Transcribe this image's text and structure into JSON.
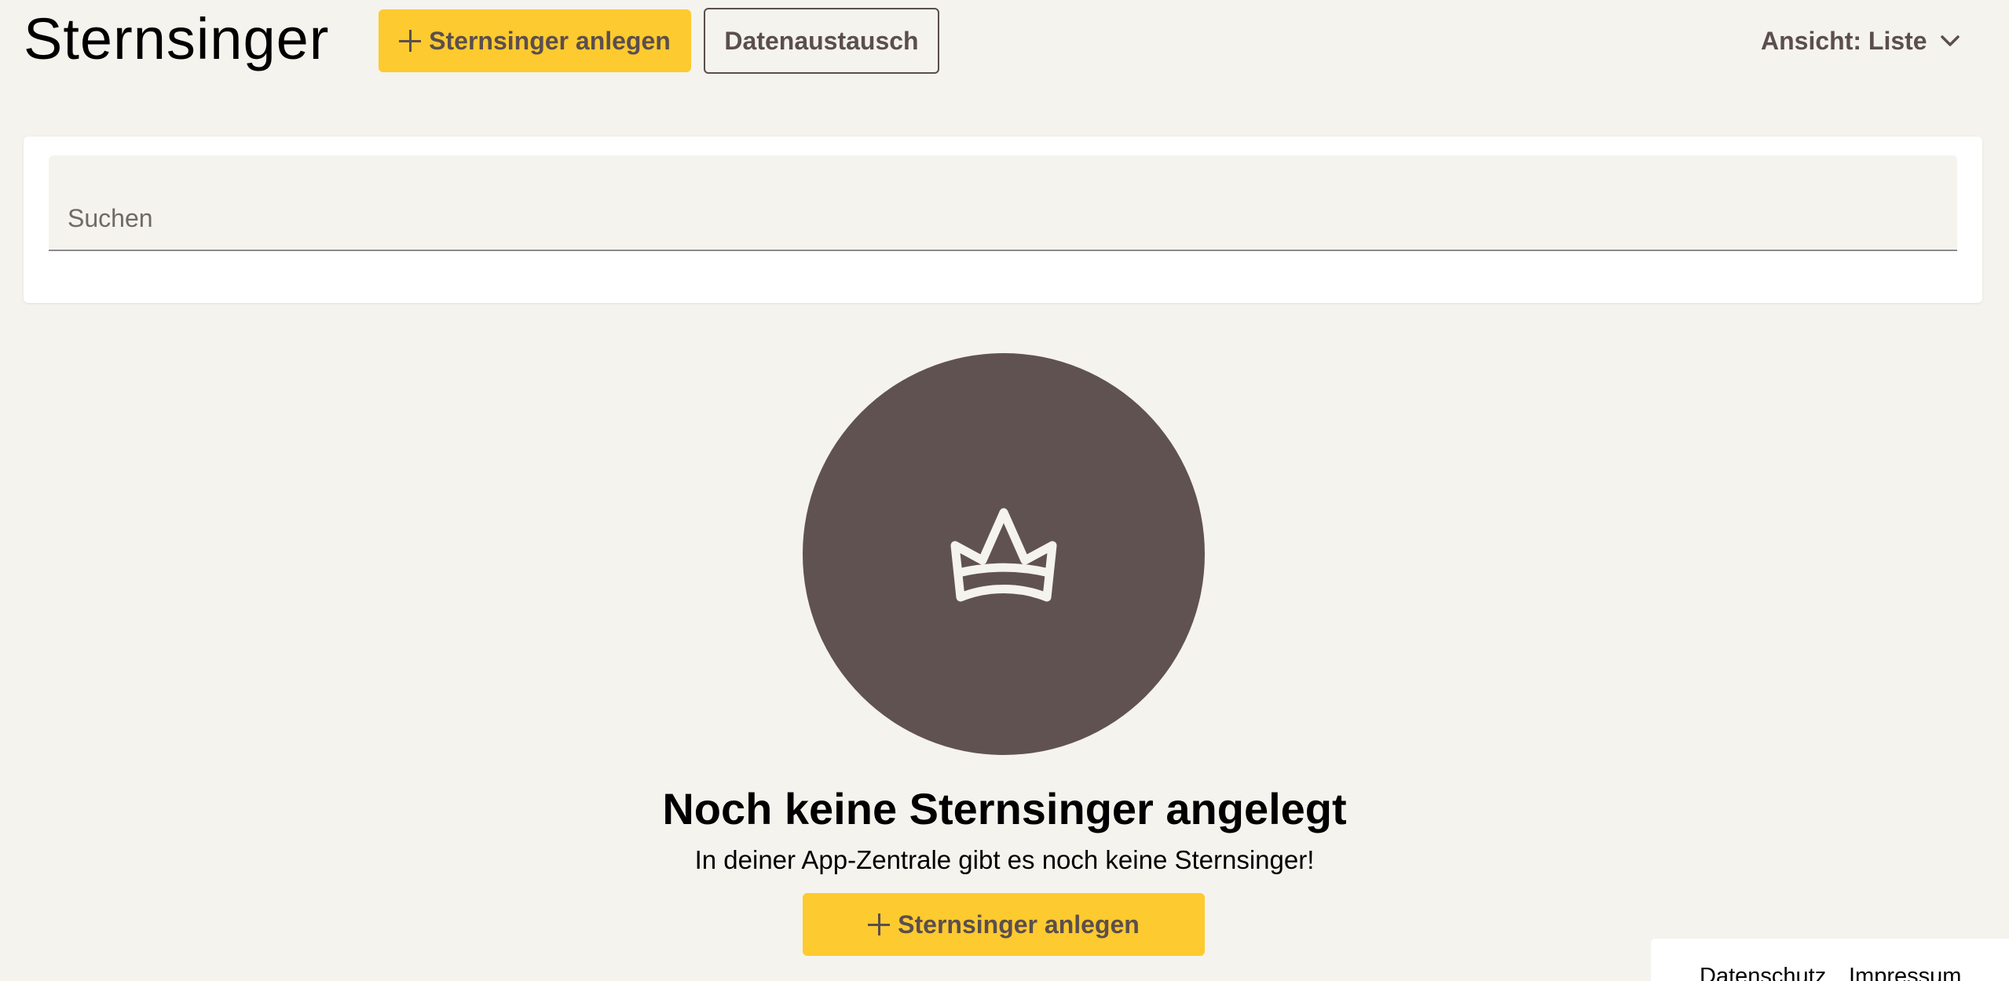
{
  "header": {
    "title": "Sternsinger",
    "create_label": "Sternsinger anlegen",
    "exchange_label": "Datenaustausch",
    "view_label": "Ansicht: Liste"
  },
  "search": {
    "placeholder": "Suchen"
  },
  "empty_state": {
    "title": "Noch keine Sternsinger angelegt",
    "text": "In deiner App-Zentrale gibt es noch keine Sternsinger!",
    "create_label": "Sternsinger anlegen",
    "icon": "crown-icon"
  },
  "footer": {
    "privacy_label": "Datenschutz",
    "imprint_label": "Impressum"
  },
  "colors": {
    "background": "#f4f3ed",
    "accent": "#fdca2f",
    "primary_text": "#5b4e4e",
    "circle": "#615252"
  }
}
